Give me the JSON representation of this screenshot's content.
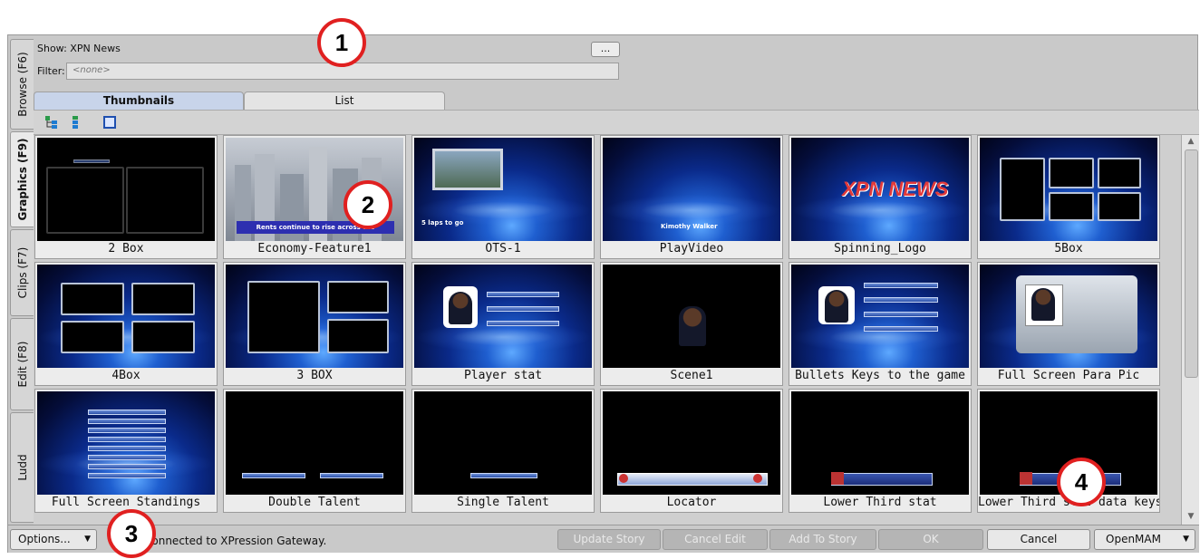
{
  "header": {
    "show_label": "Show: XPN News",
    "filter_label": "Filter:",
    "filter_placeholder": "<none>",
    "ellipsis_label": "..."
  },
  "left_tabs": [
    {
      "label": "Browse (F6)"
    },
    {
      "label": "Graphics (F9)",
      "active": true
    },
    {
      "label": "Clips (F7)"
    },
    {
      "label": "Edit (F8)"
    },
    {
      "label": "Ludd"
    }
  ],
  "view_tabs": [
    {
      "label": "Thumbnails",
      "active": true
    },
    {
      "label": "List"
    }
  ],
  "toolbar_icons": [
    "tree-view-icon",
    "hierarchy-icon",
    "select-frame-icon"
  ],
  "thumbnails": [
    {
      "caption": "2 Box"
    },
    {
      "caption": "Economy-Feature1",
      "overlay_text": "Rents continue to rise across the"
    },
    {
      "caption": "OTS-1",
      "overlay_text": "5 laps to go"
    },
    {
      "caption": "PlayVideo",
      "overlay_text": "Kimothy Walker"
    },
    {
      "caption": "Spinning_Logo",
      "overlay_text": "XPN NEWS"
    },
    {
      "caption": "5Box"
    },
    {
      "caption": "4Box"
    },
    {
      "caption": "3 BOX"
    },
    {
      "caption": "Player stat"
    },
    {
      "caption": "Scene1"
    },
    {
      "caption": "Bullets Keys to the game"
    },
    {
      "caption": "Full Screen Para Pic"
    },
    {
      "caption": "Full Screen Standings"
    },
    {
      "caption": "Double Talent"
    },
    {
      "caption": "Single Talent"
    },
    {
      "caption": "Locator"
    },
    {
      "caption": "Lower Third stat"
    },
    {
      "caption": "Lower Third stat data keys"
    }
  ],
  "bottom": {
    "options_label": "Options...",
    "status": "Connected to XPression Gateway.",
    "buttons": {
      "update_story": "Update Story",
      "cancel_edit": "Cancel Edit",
      "add_to_story": "Add To Story",
      "ok": "OK",
      "cancel": "Cancel",
      "openmam": "OpenMAM"
    }
  },
  "callouts": [
    "1",
    "2",
    "3",
    "4"
  ],
  "colors": {
    "accent_tab": "#c8d4ea",
    "callout_border": "#e02020",
    "panel": "#c9c9c9"
  }
}
